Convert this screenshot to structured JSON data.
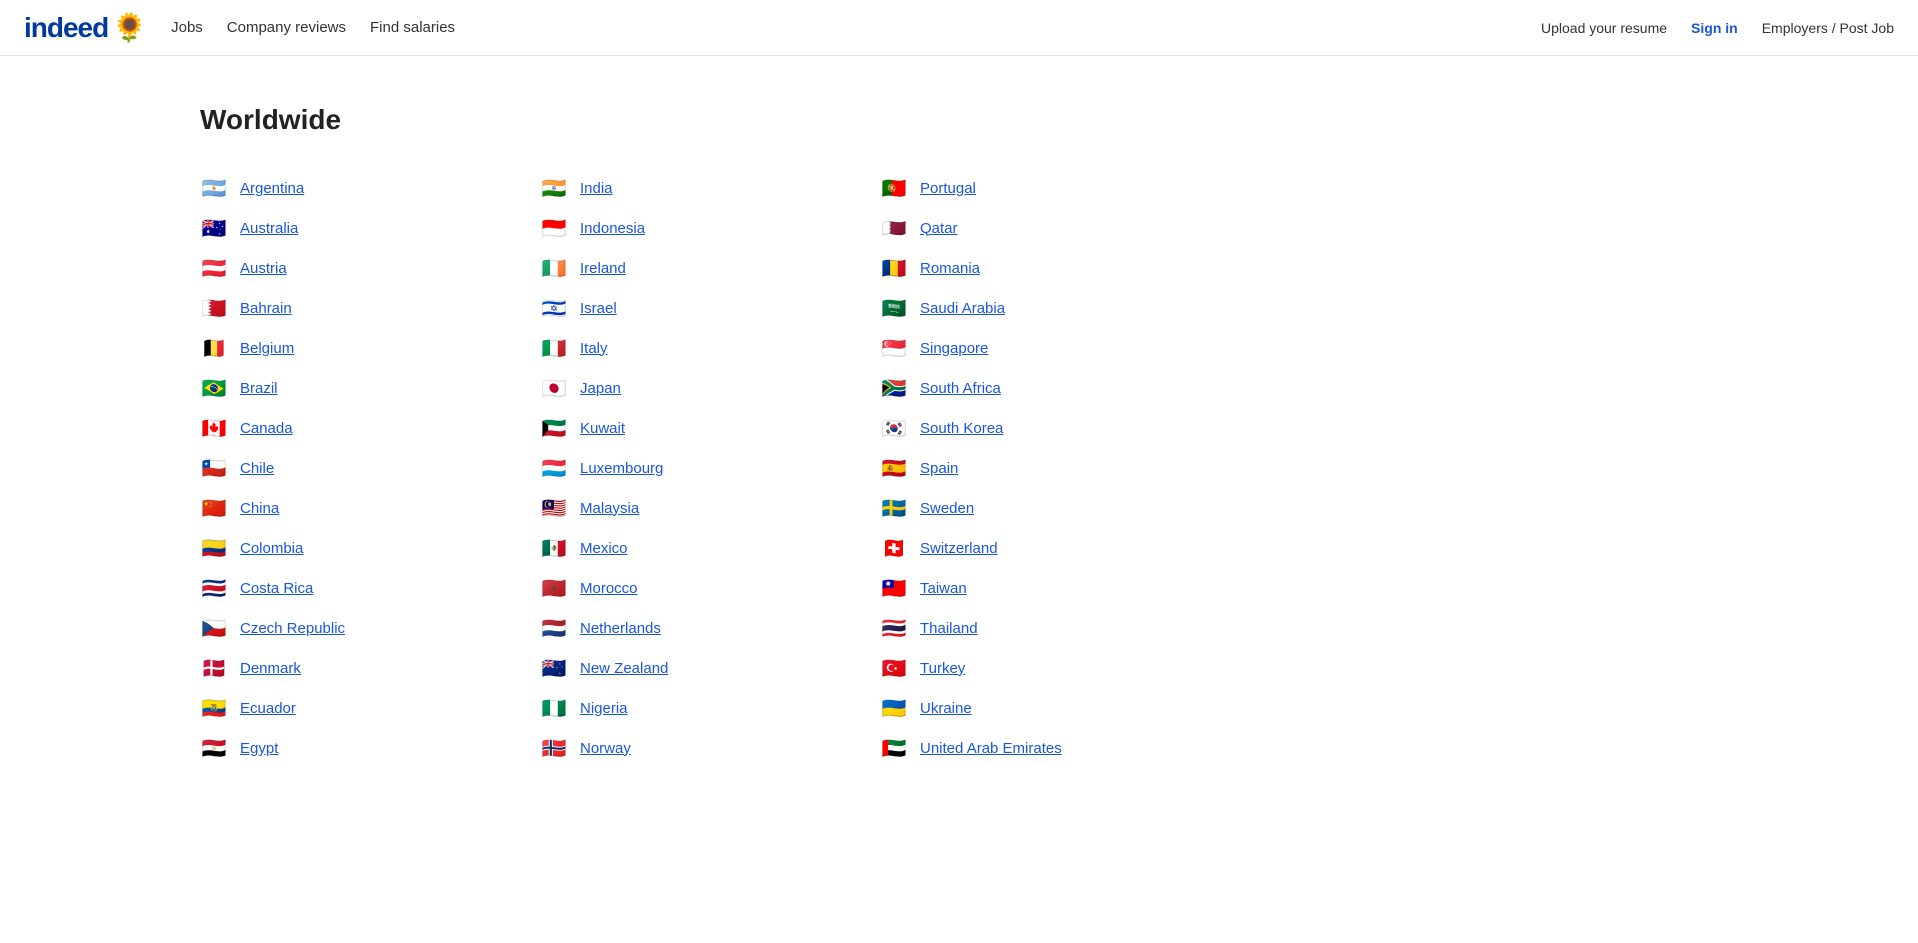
{
  "header": {
    "logo_text": "indeed",
    "logo_flower": "🌻",
    "nav": [
      {
        "label": "Jobs",
        "id": "jobs"
      },
      {
        "label": "Company reviews",
        "id": "company-reviews"
      },
      {
        "label": "Find salaries",
        "id": "find-salaries"
      }
    ],
    "upload_resume": "Upload your resume",
    "sign_in": "Sign in",
    "employers": "Employers / Post Job"
  },
  "page": {
    "title": "Worldwide"
  },
  "countries": [
    {
      "name": "Argentina",
      "flag": "🇦🇷",
      "col": 1
    },
    {
      "name": "Australia",
      "flag": "🇦🇺",
      "col": 1
    },
    {
      "name": "Austria",
      "flag": "🇦🇹",
      "col": 1
    },
    {
      "name": "Bahrain",
      "flag": "🇧🇭",
      "col": 1
    },
    {
      "name": "Belgium",
      "flag": "🇧🇪",
      "col": 1
    },
    {
      "name": "Brazil",
      "flag": "🇧🇷",
      "col": 1
    },
    {
      "name": "Canada",
      "flag": "🇨🇦",
      "col": 1
    },
    {
      "name": "Chile",
      "flag": "🇨🇱",
      "col": 1
    },
    {
      "name": "China",
      "flag": "🇨🇳",
      "col": 1
    },
    {
      "name": "Colombia",
      "flag": "🇨🇴",
      "col": 1
    },
    {
      "name": "Costa Rica",
      "flag": "🇨🇷",
      "col": 1
    },
    {
      "name": "Czech Republic",
      "flag": "🇨🇿",
      "col": 1
    },
    {
      "name": "Denmark",
      "flag": "🇩🇰",
      "col": 1
    },
    {
      "name": "Ecuador",
      "flag": "🇪🇨",
      "col": 1
    },
    {
      "name": "Egypt",
      "flag": "🇪🇬",
      "col": 1
    },
    {
      "name": "India",
      "flag": "🇮🇳",
      "col": 2
    },
    {
      "name": "Indonesia",
      "flag": "🇮🇩",
      "col": 2
    },
    {
      "name": "Ireland",
      "flag": "🇮🇪",
      "col": 2
    },
    {
      "name": "Israel",
      "flag": "🇮🇱",
      "col": 2
    },
    {
      "name": "Italy",
      "flag": "🇮🇹",
      "col": 2
    },
    {
      "name": "Japan",
      "flag": "🇯🇵",
      "col": 2
    },
    {
      "name": "Kuwait",
      "flag": "🇰🇼",
      "col": 2
    },
    {
      "name": "Luxembourg",
      "flag": "🇱🇺",
      "col": 2
    },
    {
      "name": "Malaysia",
      "flag": "🇲🇾",
      "col": 2
    },
    {
      "name": "Mexico",
      "flag": "🇲🇽",
      "col": 2
    },
    {
      "name": "Morocco",
      "flag": "🇲🇦",
      "col": 2
    },
    {
      "name": "Netherlands",
      "flag": "🇳🇱",
      "col": 2
    },
    {
      "name": "New Zealand",
      "flag": "🇳🇿",
      "col": 2
    },
    {
      "name": "Nigeria",
      "flag": "🇳🇬",
      "col": 2
    },
    {
      "name": "Norway",
      "flag": "🇳🇴",
      "col": 2
    },
    {
      "name": "Portugal",
      "flag": "🇵🇹",
      "col": 3
    },
    {
      "name": "Qatar",
      "flag": "🇶🇦",
      "col": 3
    },
    {
      "name": "Romania",
      "flag": "🇷🇴",
      "col": 3
    },
    {
      "name": "Saudi Arabia",
      "flag": "🇸🇦",
      "col": 3
    },
    {
      "name": "Singapore",
      "flag": "🇸🇬",
      "col": 3
    },
    {
      "name": "South Africa",
      "flag": "🇿🇦",
      "col": 3
    },
    {
      "name": "South Korea",
      "flag": "🇰🇷",
      "col": 3
    },
    {
      "name": "Spain",
      "flag": "🇪🇸",
      "col": 3
    },
    {
      "name": "Sweden",
      "flag": "🇸🇪",
      "col": 3
    },
    {
      "name": "Switzerland",
      "flag": "🇨🇭",
      "col": 3
    },
    {
      "name": "Taiwan",
      "flag": "🇹🇼",
      "col": 3
    },
    {
      "name": "Thailand",
      "flag": "🇹🇭",
      "col": 3
    },
    {
      "name": "Turkey",
      "flag": "🇹🇷",
      "col": 3
    },
    {
      "name": "Ukraine",
      "flag": "🇺🇦",
      "col": 3
    },
    {
      "name": "United Arab Emirates",
      "flag": "🇦🇪",
      "col": 3
    }
  ]
}
